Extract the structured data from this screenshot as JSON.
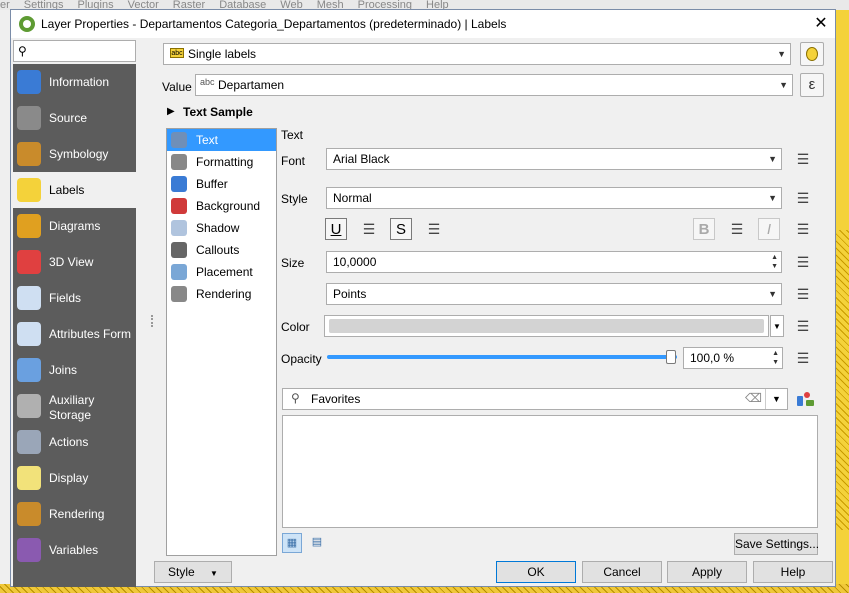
{
  "background_app": {
    "menu_items": [
      "er",
      "Settings",
      "Plugins",
      "Vector",
      "Raster",
      "Database",
      "Web",
      "Mesh",
      "Processing",
      "Help"
    ]
  },
  "window": {
    "title": "Layer Properties - Departamentos Categoria_Departamentos (predeterminado) | Labels",
    "close_glyph": "✕"
  },
  "sidebar": {
    "search_placeholder": "",
    "items": [
      {
        "label": "Information",
        "icon": "info-icon",
        "color": "#3a7bd5"
      },
      {
        "label": "Source",
        "icon": "wrench-icon",
        "color": "#8a8a8a"
      },
      {
        "label": "Symbology",
        "icon": "paintbrush-icon",
        "color": "#c98b2b"
      },
      {
        "label": "Labels",
        "icon": "abc-label-icon",
        "color": "#f4d23a"
      },
      {
        "label": "Diagrams",
        "icon": "diagram-icon",
        "color": "#e0a020"
      },
      {
        "label": "3D View",
        "icon": "cube-icon",
        "color": "#e04040"
      },
      {
        "label": "Fields",
        "icon": "fields-icon",
        "color": "#cfdff2"
      },
      {
        "label": "Attributes Form",
        "icon": "form-icon",
        "color": "#cfdff2"
      },
      {
        "label": "Joins",
        "icon": "join-icon",
        "color": "#6aa0e0"
      },
      {
        "label": "Auxiliary Storage",
        "icon": "database-icon",
        "color": "#b0b0b0"
      },
      {
        "label": "Actions",
        "icon": "gear-icon",
        "color": "#9aa6b8"
      },
      {
        "label": "Display",
        "icon": "speech-bubble-icon",
        "color": "#f2e27a"
      },
      {
        "label": "Rendering",
        "icon": "paintbrush-icon",
        "color": "#c98b2b"
      },
      {
        "label": "Variables",
        "icon": "epsilon-icon",
        "color": "#8a5ab0"
      }
    ]
  },
  "labels_panel": {
    "mode": "Single labels",
    "mode_icon": "abc",
    "value_label": "Value",
    "value_icon": "abc",
    "value_field": "Departamen",
    "expression_glyph": "ε",
    "text_sample_label": "Text Sample"
  },
  "subnav": {
    "items": [
      {
        "label": "Text",
        "icon": "abc-text-icon"
      },
      {
        "label": "Formatting",
        "icon": "formatting-icon"
      },
      {
        "label": "Buffer",
        "icon": "buffer-icon"
      },
      {
        "label": "Background",
        "icon": "background-icon"
      },
      {
        "label": "Shadow",
        "icon": "shadow-icon"
      },
      {
        "label": "Callouts",
        "icon": "callout-icon"
      },
      {
        "label": "Placement",
        "icon": "placement-icon"
      },
      {
        "label": "Rendering",
        "icon": "rendering-icon"
      }
    ],
    "selected": "Text"
  },
  "text_settings": {
    "section_title": "Text",
    "font_label": "Font",
    "font_value": "Arial Black",
    "style_label": "Style",
    "style_value": "Normal",
    "underline_glyph": "U",
    "strike_glyph": "S",
    "bold_glyph": "B",
    "italic_glyph": "I",
    "size_label": "Size",
    "size_value": "10,0000",
    "unit_value": "Points",
    "color_label": "Color",
    "color_value": "#d3d3d3",
    "opacity_label": "Opacity",
    "opacity_value": "100,0 %",
    "opacity_fraction": 1.0
  },
  "favorites": {
    "search_value": "Favorites"
  },
  "buttons": {
    "save_settings": "Save Settings...",
    "style": "Style",
    "ok": "OK",
    "cancel": "Cancel",
    "apply": "Apply",
    "help": "Help"
  }
}
